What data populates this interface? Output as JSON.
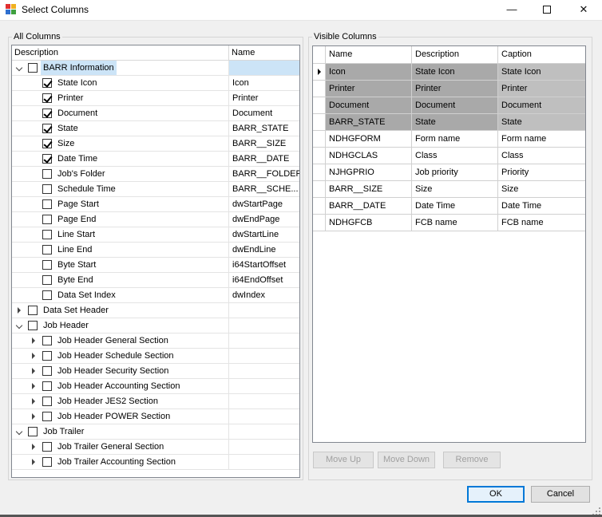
{
  "window": {
    "title": "Select Columns",
    "minimize": "—",
    "close": "✕"
  },
  "icons": {
    "app": "app-grid-icon"
  },
  "all_columns": {
    "label": "All Columns",
    "headers": {
      "description": "Description",
      "name": "Name"
    },
    "rows": [
      {
        "desc": "BARR Information",
        "name": "",
        "level": 0,
        "expander": "expanded",
        "checked": false,
        "selected": true
      },
      {
        "desc": "State Icon",
        "name": "Icon",
        "level": 1,
        "expander": "",
        "checked": true
      },
      {
        "desc": "Printer",
        "name": "Printer",
        "level": 1,
        "expander": "",
        "checked": true
      },
      {
        "desc": "Document",
        "name": "Document",
        "level": 1,
        "expander": "",
        "checked": true
      },
      {
        "desc": "State",
        "name": "BARR_STATE",
        "level": 1,
        "expander": "",
        "checked": true
      },
      {
        "desc": "Size",
        "name": "BARR__SIZE",
        "level": 1,
        "expander": "",
        "checked": true
      },
      {
        "desc": "Date Time",
        "name": "BARR__DATE",
        "level": 1,
        "expander": "",
        "checked": true
      },
      {
        "desc": "Job's Folder",
        "name": "BARR__FOLDER",
        "level": 1,
        "expander": "",
        "checked": false
      },
      {
        "desc": "Schedule Time",
        "name": "BARR__SCHE...",
        "level": 1,
        "expander": "",
        "checked": false
      },
      {
        "desc": "Page Start",
        "name": "dwStartPage",
        "level": 1,
        "expander": "",
        "checked": false
      },
      {
        "desc": "Page End",
        "name": "dwEndPage",
        "level": 1,
        "expander": "",
        "checked": false
      },
      {
        "desc": "Line Start",
        "name": "dwStartLine",
        "level": 1,
        "expander": "",
        "checked": false
      },
      {
        "desc": "Line End",
        "name": "dwEndLine",
        "level": 1,
        "expander": "",
        "checked": false
      },
      {
        "desc": "Byte Start",
        "name": "i64StartOffset",
        "level": 1,
        "expander": "",
        "checked": false
      },
      {
        "desc": "Byte End",
        "name": "i64EndOffset",
        "level": 1,
        "expander": "",
        "checked": false
      },
      {
        "desc": "Data Set Index",
        "name": "dwIndex",
        "level": 1,
        "expander": "",
        "checked": false
      },
      {
        "desc": "Data Set Header",
        "name": "",
        "level": 0,
        "expander": "collapsed",
        "checked": false
      },
      {
        "desc": "Job Header",
        "name": "",
        "level": 0,
        "expander": "expanded",
        "checked": false
      },
      {
        "desc": "Job Header General Section",
        "name": "",
        "level": 1,
        "expander": "collapsed",
        "checked": false
      },
      {
        "desc": "Job Header Schedule Section",
        "name": "",
        "level": 1,
        "expander": "collapsed",
        "checked": false
      },
      {
        "desc": "Job Header Security Section",
        "name": "",
        "level": 1,
        "expander": "collapsed",
        "checked": false
      },
      {
        "desc": "Job Header Accounting Section",
        "name": "",
        "level": 1,
        "expander": "collapsed",
        "checked": false
      },
      {
        "desc": "Job Header JES2 Section",
        "name": "",
        "level": 1,
        "expander": "collapsed",
        "checked": false
      },
      {
        "desc": "Job Header POWER Section",
        "name": "",
        "level": 1,
        "expander": "collapsed",
        "checked": false
      },
      {
        "desc": "Job Trailer",
        "name": "",
        "level": 0,
        "expander": "expanded",
        "checked": false
      },
      {
        "desc": "Job Trailer General Section",
        "name": "",
        "level": 1,
        "expander": "collapsed",
        "checked": false
      },
      {
        "desc": "Job Trailer Accounting Section",
        "name": "",
        "level": 1,
        "expander": "collapsed",
        "checked": false
      }
    ]
  },
  "visible_columns": {
    "label": "Visible Columns",
    "headers": {
      "name": "Name",
      "description": "Description",
      "caption": "Caption"
    },
    "rows": [
      {
        "name": "Icon",
        "description": "State Icon",
        "caption": "State Icon",
        "highlight": true,
        "current": true
      },
      {
        "name": "Printer",
        "description": "Printer",
        "caption": "Printer",
        "highlight": true
      },
      {
        "name": "Document",
        "description": "Document",
        "caption": "Document",
        "highlight": true
      },
      {
        "name": "BARR_STATE",
        "description": "State",
        "caption": "State",
        "highlight": true
      },
      {
        "name": "NDHGFORM",
        "description": "Form name",
        "caption": "Form name"
      },
      {
        "name": "NDHGCLAS",
        "description": "Class",
        "caption": "Class"
      },
      {
        "name": "NJHGPRIO",
        "description": "Job priority",
        "caption": "Priority"
      },
      {
        "name": "BARR__SIZE",
        "description": "Size",
        "caption": "Size"
      },
      {
        "name": "BARR__DATE",
        "description": "Date Time",
        "caption": "Date Time"
      },
      {
        "name": "NDHGFCB",
        "description": "FCB name",
        "caption": "FCB name"
      }
    ]
  },
  "buttons": {
    "move_up": "Move Up",
    "move_down": "Move Down",
    "remove": "Remove",
    "ok": "OK",
    "cancel": "Cancel"
  },
  "colors": {
    "selection": "#cce4f7",
    "highlight_row": "#a9a9a9",
    "accent": "#0078d7"
  }
}
